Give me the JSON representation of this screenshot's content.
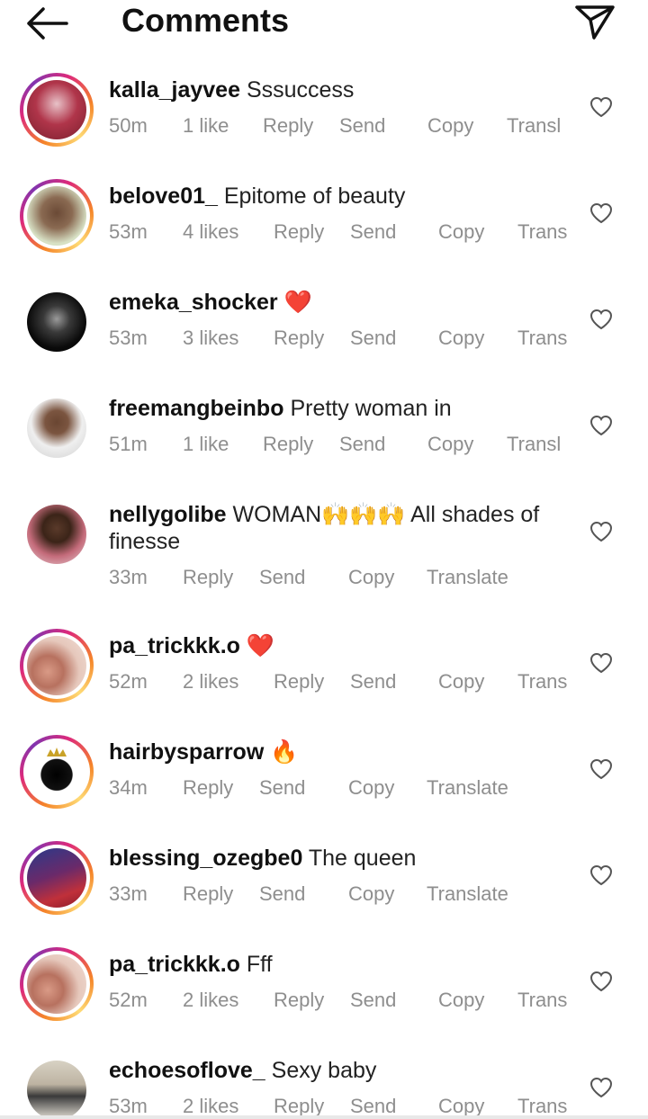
{
  "header": {
    "title": "Comments",
    "back_icon": "arrow-left-icon",
    "share_icon": "paper-plane-icon"
  },
  "comments": [
    {
      "username": "kalla_jayvee",
      "text": "Sssuccess",
      "time": "50m",
      "likes": "1 like",
      "reply": "Reply",
      "send": "Send",
      "copy": "Copy",
      "translate": "Transl",
      "story_ring": true
    },
    {
      "username": "belove01_",
      "text": "Epitome of beauty",
      "time": "53m",
      "likes": "4 likes",
      "reply": "Reply",
      "send": "Send",
      "copy": "Copy",
      "translate": "Trans",
      "story_ring": true
    },
    {
      "username": "emeka_shocker",
      "text": "❤️",
      "time": "53m",
      "likes": "3 likes",
      "reply": "Reply",
      "send": "Send",
      "copy": "Copy",
      "translate": "Trans",
      "story_ring": false
    },
    {
      "username": "freemangbeinbo",
      "text": "Pretty woman in",
      "time": "51m",
      "likes": "1 like",
      "reply": "Reply",
      "send": "Send",
      "copy": "Copy",
      "translate": "Transl",
      "story_ring": false
    },
    {
      "username": "nellygolibe",
      "text": "WOMAN🙌🙌🙌 All shades of finesse",
      "time": "33m",
      "likes": "",
      "reply": "Reply",
      "send": "Send",
      "copy": "Copy",
      "translate": "Translate",
      "story_ring": false
    },
    {
      "username": "pa_trickkk.o",
      "text": "❤️",
      "time": "52m",
      "likes": "2 likes",
      "reply": "Reply",
      "send": "Send",
      "copy": "Copy",
      "translate": "Trans",
      "story_ring": true
    },
    {
      "username": "hairbysparrow",
      "text": "🔥",
      "time": "34m",
      "likes": "",
      "reply": "Reply",
      "send": "Send",
      "copy": "Copy",
      "translate": "Translate",
      "story_ring": true
    },
    {
      "username": "blessing_ozegbe0",
      "text": "The queen",
      "time": "33m",
      "likes": "",
      "reply": "Reply",
      "send": "Send",
      "copy": "Copy",
      "translate": "Translate",
      "story_ring": true
    },
    {
      "username": "pa_trickkk.o",
      "text": "Fff",
      "time": "52m",
      "likes": "2 likes",
      "reply": "Reply",
      "send": "Send",
      "copy": "Copy",
      "translate": "Trans",
      "story_ring": true
    },
    {
      "username": "echoesoflove_",
      "text": "Sexy baby",
      "time": "53m",
      "likes": "2 likes",
      "reply": "Reply",
      "send": "Send",
      "copy": "Copy",
      "translate": "Trans",
      "story_ring": false
    }
  ],
  "colors": {
    "text": "#111111",
    "meta": "#8e8e8e",
    "ring_start": "#f58529",
    "ring_mid": "#dd2a7b",
    "ring_end": "#8134af"
  }
}
